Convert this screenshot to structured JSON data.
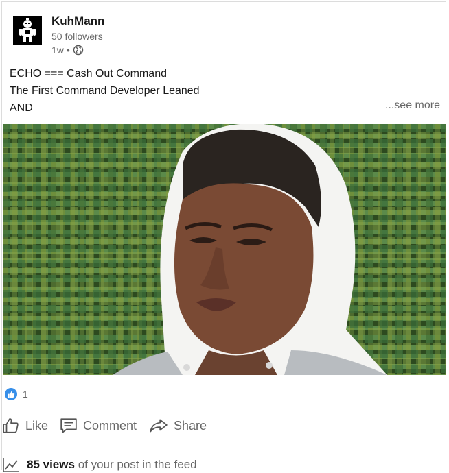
{
  "post": {
    "author": {
      "name": "KuhMann",
      "followers": "50 followers",
      "time": "1w",
      "separator": "•",
      "avatar_icon": "robot-figure-icon",
      "visibility_icon": "globe-icon"
    },
    "body_lines": [
      "ECHO === Cash Out Command",
      "The First Command Developer Leaned",
      "AND"
    ],
    "see_more_label": "...see more",
    "image": {
      "icon": "portrait-photo"
    },
    "reactions": {
      "count": "1",
      "icon": "thumbs-up-icon"
    },
    "actions": {
      "like_label": "Like",
      "comment_label": "Comment",
      "share_label": "Share"
    },
    "analytics": {
      "views_count": "85 views",
      "views_suffix": "of your post in the feed",
      "icon": "chart-line-icon"
    }
  },
  "colors": {
    "reaction_blue": "#378fe9",
    "secondary_text": "#666666",
    "primary_text": "#191919"
  }
}
